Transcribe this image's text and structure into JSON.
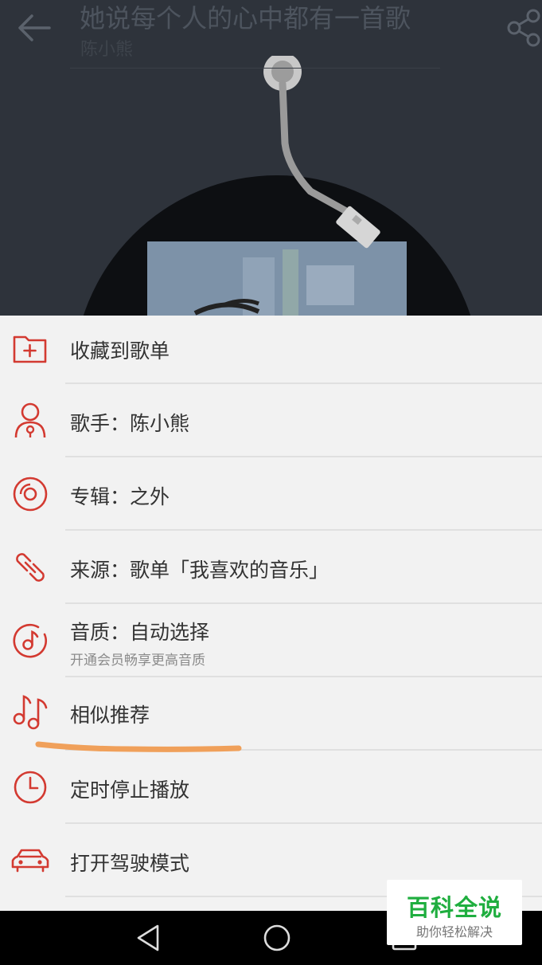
{
  "header": {
    "back_icon": "arrow-left-icon",
    "title": "她说每个人的心中都有一首歌",
    "artist": "陈小熊",
    "share_icon": "share-icon"
  },
  "menu": {
    "items": [
      {
        "icon": "folder-plus-icon",
        "label": "收藏到歌单"
      },
      {
        "icon": "singer-icon",
        "label": "歌手：陈小熊"
      },
      {
        "icon": "album-disc-icon",
        "label": "专辑：之外"
      },
      {
        "icon": "link-icon",
        "label": "来源：歌单「我喜欢的音乐」"
      },
      {
        "icon": "quality-note-icon",
        "label": "音质：自动选择",
        "sub": "开通会员畅享更高音质"
      },
      {
        "icon": "music-notes-icon",
        "label": "相似推荐"
      },
      {
        "icon": "clock-icon",
        "label": "定时停止播放"
      },
      {
        "icon": "car-icon",
        "label": "打开驾驶模式"
      }
    ],
    "accent_color": "#d33a31",
    "highlight_color": "#f0a05a"
  },
  "watermark": {
    "title": "百科全说",
    "subtitle": "助你轻松解决"
  }
}
